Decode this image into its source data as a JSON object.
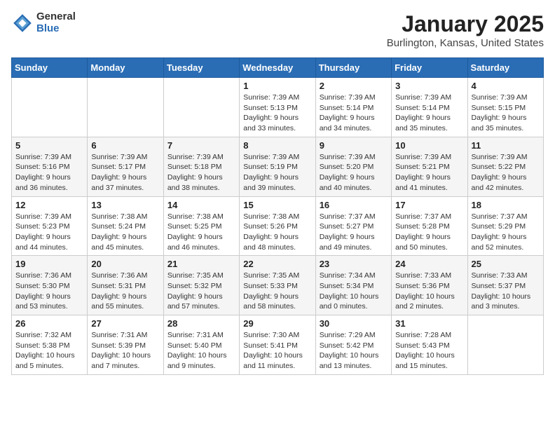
{
  "logo": {
    "general": "General",
    "blue": "Blue"
  },
  "header": {
    "month": "January 2025",
    "location": "Burlington, Kansas, United States"
  },
  "weekdays": [
    "Sunday",
    "Monday",
    "Tuesday",
    "Wednesday",
    "Thursday",
    "Friday",
    "Saturday"
  ],
  "weeks": [
    [
      {
        "day": "",
        "content": ""
      },
      {
        "day": "",
        "content": ""
      },
      {
        "day": "",
        "content": ""
      },
      {
        "day": "1",
        "content": "Sunrise: 7:39 AM\nSunset: 5:13 PM\nDaylight: 9 hours\nand 33 minutes."
      },
      {
        "day": "2",
        "content": "Sunrise: 7:39 AM\nSunset: 5:14 PM\nDaylight: 9 hours\nand 34 minutes."
      },
      {
        "day": "3",
        "content": "Sunrise: 7:39 AM\nSunset: 5:14 PM\nDaylight: 9 hours\nand 35 minutes."
      },
      {
        "day": "4",
        "content": "Sunrise: 7:39 AM\nSunset: 5:15 PM\nDaylight: 9 hours\nand 35 minutes."
      }
    ],
    [
      {
        "day": "5",
        "content": "Sunrise: 7:39 AM\nSunset: 5:16 PM\nDaylight: 9 hours\nand 36 minutes."
      },
      {
        "day": "6",
        "content": "Sunrise: 7:39 AM\nSunset: 5:17 PM\nDaylight: 9 hours\nand 37 minutes."
      },
      {
        "day": "7",
        "content": "Sunrise: 7:39 AM\nSunset: 5:18 PM\nDaylight: 9 hours\nand 38 minutes."
      },
      {
        "day": "8",
        "content": "Sunrise: 7:39 AM\nSunset: 5:19 PM\nDaylight: 9 hours\nand 39 minutes."
      },
      {
        "day": "9",
        "content": "Sunrise: 7:39 AM\nSunset: 5:20 PM\nDaylight: 9 hours\nand 40 minutes."
      },
      {
        "day": "10",
        "content": "Sunrise: 7:39 AM\nSunset: 5:21 PM\nDaylight: 9 hours\nand 41 minutes."
      },
      {
        "day": "11",
        "content": "Sunrise: 7:39 AM\nSunset: 5:22 PM\nDaylight: 9 hours\nand 42 minutes."
      }
    ],
    [
      {
        "day": "12",
        "content": "Sunrise: 7:39 AM\nSunset: 5:23 PM\nDaylight: 9 hours\nand 44 minutes."
      },
      {
        "day": "13",
        "content": "Sunrise: 7:38 AM\nSunset: 5:24 PM\nDaylight: 9 hours\nand 45 minutes."
      },
      {
        "day": "14",
        "content": "Sunrise: 7:38 AM\nSunset: 5:25 PM\nDaylight: 9 hours\nand 46 minutes."
      },
      {
        "day": "15",
        "content": "Sunrise: 7:38 AM\nSunset: 5:26 PM\nDaylight: 9 hours\nand 48 minutes."
      },
      {
        "day": "16",
        "content": "Sunrise: 7:37 AM\nSunset: 5:27 PM\nDaylight: 9 hours\nand 49 minutes."
      },
      {
        "day": "17",
        "content": "Sunrise: 7:37 AM\nSunset: 5:28 PM\nDaylight: 9 hours\nand 50 minutes."
      },
      {
        "day": "18",
        "content": "Sunrise: 7:37 AM\nSunset: 5:29 PM\nDaylight: 9 hours\nand 52 minutes."
      }
    ],
    [
      {
        "day": "19",
        "content": "Sunrise: 7:36 AM\nSunset: 5:30 PM\nDaylight: 9 hours\nand 53 minutes."
      },
      {
        "day": "20",
        "content": "Sunrise: 7:36 AM\nSunset: 5:31 PM\nDaylight: 9 hours\nand 55 minutes."
      },
      {
        "day": "21",
        "content": "Sunrise: 7:35 AM\nSunset: 5:32 PM\nDaylight: 9 hours\nand 57 minutes."
      },
      {
        "day": "22",
        "content": "Sunrise: 7:35 AM\nSunset: 5:33 PM\nDaylight: 9 hours\nand 58 minutes."
      },
      {
        "day": "23",
        "content": "Sunrise: 7:34 AM\nSunset: 5:34 PM\nDaylight: 10 hours\nand 0 minutes."
      },
      {
        "day": "24",
        "content": "Sunrise: 7:33 AM\nSunset: 5:36 PM\nDaylight: 10 hours\nand 2 minutes."
      },
      {
        "day": "25",
        "content": "Sunrise: 7:33 AM\nSunset: 5:37 PM\nDaylight: 10 hours\nand 3 minutes."
      }
    ],
    [
      {
        "day": "26",
        "content": "Sunrise: 7:32 AM\nSunset: 5:38 PM\nDaylight: 10 hours\nand 5 minutes."
      },
      {
        "day": "27",
        "content": "Sunrise: 7:31 AM\nSunset: 5:39 PM\nDaylight: 10 hours\nand 7 minutes."
      },
      {
        "day": "28",
        "content": "Sunrise: 7:31 AM\nSunset: 5:40 PM\nDaylight: 10 hours\nand 9 minutes."
      },
      {
        "day": "29",
        "content": "Sunrise: 7:30 AM\nSunset: 5:41 PM\nDaylight: 10 hours\nand 11 minutes."
      },
      {
        "day": "30",
        "content": "Sunrise: 7:29 AM\nSunset: 5:42 PM\nDaylight: 10 hours\nand 13 minutes."
      },
      {
        "day": "31",
        "content": "Sunrise: 7:28 AM\nSunset: 5:43 PM\nDaylight: 10 hours\nand 15 minutes."
      },
      {
        "day": "",
        "content": ""
      }
    ]
  ]
}
